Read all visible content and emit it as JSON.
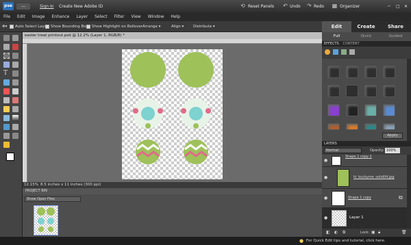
{
  "topbar": {
    "logo": "pse",
    "minimize": "—",
    "signin": "Sign In",
    "create_id": "Create New Adobe ID",
    "reset_panels": "Reset Panels",
    "undo": "Undo",
    "redo": "Redo",
    "organizer": "Organizer"
  },
  "menu": [
    "File",
    "Edit",
    "Image",
    "Enhance",
    "Layer",
    "Select",
    "Filter",
    "View",
    "Window",
    "Help"
  ],
  "options": {
    "auto_select": "Auto Select Layer",
    "bounding_box": "Show Bounding Box",
    "highlight": "Show Highlight on Rollover",
    "arrange": "Arrange ▾",
    "align": "Align ▾",
    "distribute": "Distribute ▾"
  },
  "mode_tabs": [
    "Edit",
    "Create",
    "Share"
  ],
  "sub_tabs": [
    "Full",
    "Quick",
    "Guided"
  ],
  "document": {
    "tab_title": "easter treat printout.psd @ 12.2% (Layer 1, RGB/8) *",
    "zoom": "12.15%",
    "doc_size": "8.5 inches x 11 inches (300 ppi)"
  },
  "project_bin": {
    "header": "PROJECT BIN",
    "select": "Show Open Files"
  },
  "effects": {
    "tab1": "EFFECTS",
    "tab2": "CONTENT",
    "apply": "Apply"
  },
  "layers": {
    "header": "LAYERS",
    "blend_mode": "Normal",
    "opacity_label": "Opacity:",
    "opacity_value": "100%",
    "lock_label": "Lock:",
    "items": [
      {
        "name": "Shape 1 copy 2"
      },
      {
        "name": "hi_buckyme_solid04.jpg"
      },
      {
        "name": "Shape 1 copy"
      },
      {
        "name": "Layer 1"
      }
    ]
  },
  "footer": {
    "tip": "For Quick Edit tips and tutorial, click here."
  },
  "colors": {
    "accent": "#2a6fb8",
    "shape_green": "#9ec15a",
    "shape_pink": "#e06b8a",
    "shape_teal": "#7ed2cf"
  }
}
